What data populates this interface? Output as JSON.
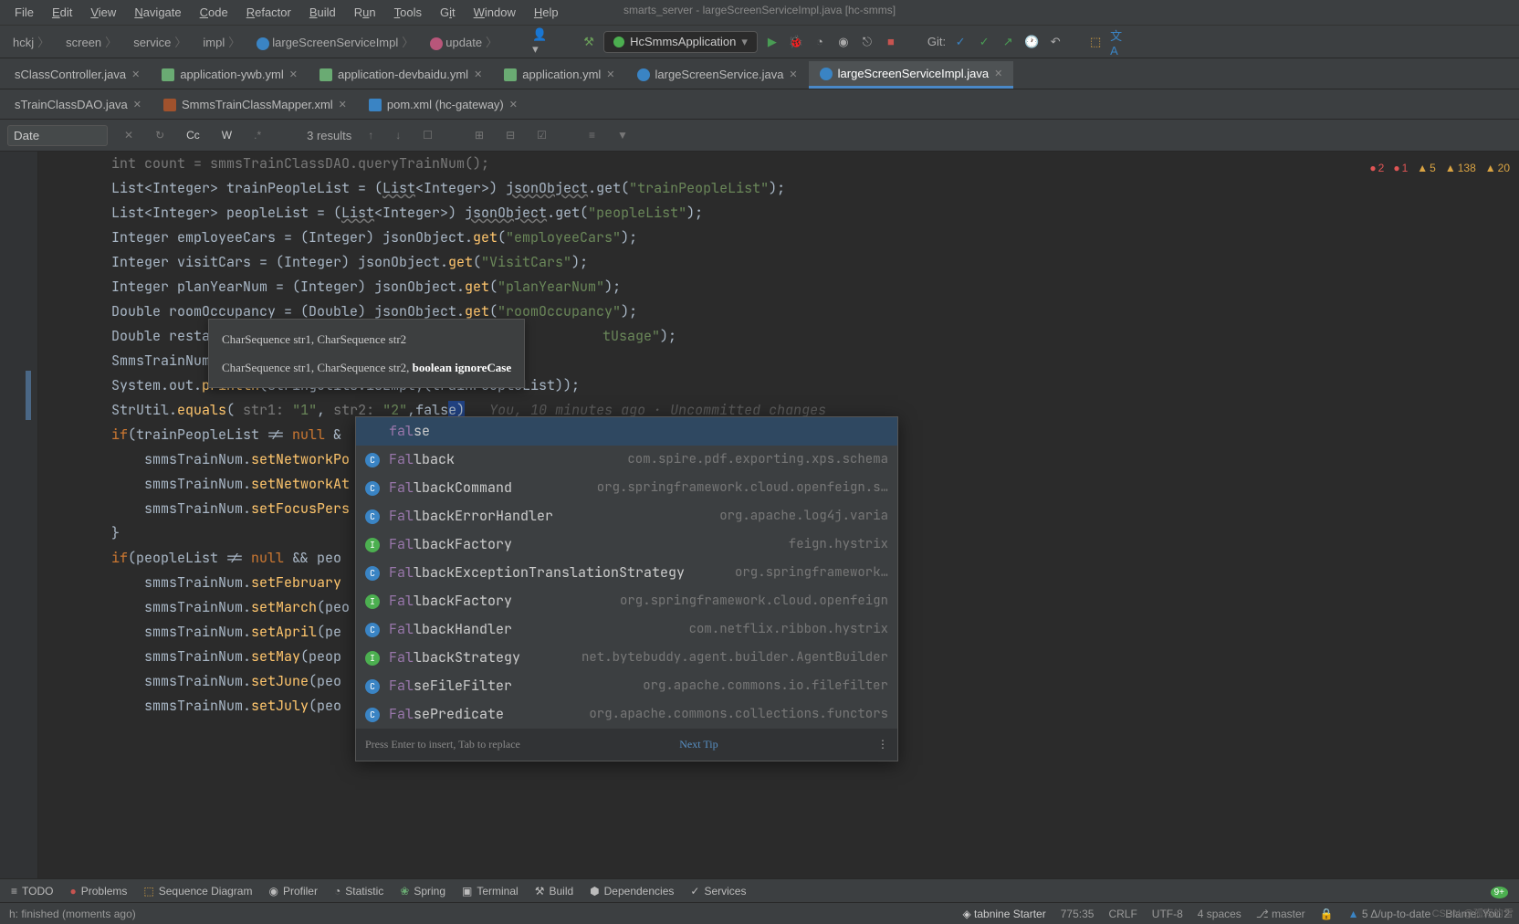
{
  "title": "smarts_server - largeScreenServiceImpl.java [hc-smms]",
  "menu": [
    "File",
    "Edit",
    "View",
    "Navigate",
    "Code",
    "Refactor",
    "Build",
    "Run",
    "Tools",
    "Git",
    "Window",
    "Help"
  ],
  "breadcrumbs": [
    "hckj",
    "screen",
    "service",
    "impl",
    "largeScreenServiceImpl",
    "update"
  ],
  "runConfig": "HcSmmsApplication",
  "gitLabel": "Git:",
  "tabsTop": [
    {
      "label": "sClassController.java",
      "icon": "#3a84c4"
    },
    {
      "label": "application-ywb.yml",
      "icon": "#6aab73"
    },
    {
      "label": "application-devbaidu.yml",
      "icon": "#6aab73"
    },
    {
      "label": "application.yml",
      "icon": "#6aab73"
    },
    {
      "label": "largeScreenService.java",
      "icon": "#3a84c4"
    },
    {
      "label": "largeScreenServiceImpl.java",
      "icon": "#3a84c4",
      "active": true
    }
  ],
  "tabsBottom": [
    {
      "label": "sTrainClassDAO.java",
      "icon": "#3a84c4"
    },
    {
      "label": "SmmsTrainClassMapper.xml",
      "icon": "#a0522d"
    },
    {
      "label": "pom.xml (hc-gateway)",
      "icon": "#3a84c4"
    }
  ],
  "find": {
    "placeholder": "Date",
    "results": "3 results"
  },
  "inspections": {
    "err1": "2",
    "err2": "1",
    "warn1": "5",
    "warn2": "138",
    "warn3": "20"
  },
  "paramPopup": {
    "row1": "CharSequence str1, CharSequence str2",
    "row2a": "CharSequence str1, CharSequence str2, ",
    "row2b": "boolean ignoreCase"
  },
  "code": {
    "l0_pre": "int count = smmsTrainClassDAO.queryTrainNum();",
    "l1": {
      "a": "List<Integer> trainPeopleList = (",
      "b": "List",
      "c": "<Integer>) ",
      "d": "jsonObject",
      "e": ".get(",
      "f": "\"trainPeopleList\"",
      "g": ");"
    },
    "l2": {
      "a": "List<Integer> peopleList = (",
      "b": "List",
      "c": "<Integer>) ",
      "d": "jsonObject",
      "e": ".get(",
      "f": "\"peopleList\"",
      "g": ");"
    },
    "l3": {
      "a": "Integer employeeCars = (Integer) jsonObject.",
      "b": "get",
      "c": "(",
      "d": "\"employeeCars\"",
      "e": ");"
    },
    "l4": {
      "a": "Integer visitCars = (Integer) jsonObject.",
      "b": "get",
      "c": "(",
      "d": "\"VisitCars\"",
      "e": ");"
    },
    "l5": {
      "a": "Integer planYearNum = (Integer) jsonObject.",
      "b": "get",
      "c": "(",
      "d": "\"planYearNum\"",
      "e": ");"
    },
    "l6": {
      "a": "Double roomOccupancy = (Double) jsonObject.",
      "b": "get",
      "c": "(",
      "d": "\"roomOccupancy\"",
      "e": ");"
    },
    "l7": {
      "a": "Double resta",
      "b": "tUsage\"",
      "c": ");"
    },
    "l8": "SmmsTrainNum",
    "l9": {
      "a": "System.out.",
      "b": "println",
      "c": "(StringUtils.isEmpty(trainPeopleList));"
    },
    "l10": {
      "a": "StrUtil.",
      "b": "equals",
      "c": "( ",
      "h1": "str1:",
      "d": " \"1\"",
      "e": ", ",
      "h2": "str2:",
      "f": " \"2\"",
      "g": ",fals",
      "h": "e)",
      "annot": "You, 10 minutes ago · Uncommitted changes"
    },
    "l11": {
      "a": "if",
      "b": "(trainPeopleList != ",
      "c": "null",
      "d": " &"
    },
    "l12": {
      "a": "    smmsTrainNum.",
      "b": "setNetworkPo"
    },
    "l13": {
      "a": "    smmsTrainNum.",
      "b": "setNetworkAt"
    },
    "l14": {
      "a": "    smmsTrainNum.",
      "b": "setFocusPers"
    },
    "l15": "}",
    "l16": {
      "a": "if",
      "b": "(peopleList != ",
      "c": "null",
      "d": " && peo"
    },
    "l17": {
      "a": "    smmsTrainNum.",
      "b": "setFebruary"
    },
    "l18": {
      "a": "    smmsTrainNum.",
      "b": "setMarch",
      "c": "(peo"
    },
    "l19": {
      "a": "    smmsTrainNum.",
      "b": "setApril",
      "c": "(pe"
    },
    "l20": {
      "a": "    smmsTrainNum.",
      "b": "setMay",
      "c": "(peop"
    },
    "l21": {
      "a": "    smmsTrainNum.",
      "b": "setJune",
      "c": "(peo"
    },
    "l22": {
      "a": "    smmsTrainNum.",
      "b": "setJuly",
      "c": "(peo"
    }
  },
  "completion": [
    {
      "ic": "",
      "name": "false",
      "match": "fal",
      "pkg": ""
    },
    {
      "ic": "C",
      "col": "#3a84c4",
      "name": "Fallback",
      "match": "Fal",
      "pkg": "com.spire.pdf.exporting.xps.schema"
    },
    {
      "ic": "C",
      "col": "#3a84c4",
      "name": "FallbackCommand<T>",
      "match": "Fal",
      "pkg": "org.springframework.cloud.openfeign.s…"
    },
    {
      "ic": "C",
      "col": "#3a84c4",
      "name": "FallbackErrorHandler",
      "match": "Fal",
      "pkg": "org.apache.log4j.varia"
    },
    {
      "ic": "I",
      "col": "#4caf50",
      "name": "FallbackFactory<T>",
      "match": "Fal",
      "pkg": "feign.hystrix"
    },
    {
      "ic": "C",
      "col": "#3a84c4",
      "name": "FallbackExceptionTranslationStrategy",
      "match": "Fal",
      "pkg": "org.springframework…"
    },
    {
      "ic": "I",
      "col": "#4caf50",
      "name": "FallbackFactory<T>",
      "match": "Fal",
      "pkg": "org.springframework.cloud.openfeign"
    },
    {
      "ic": "C",
      "col": "#3a84c4",
      "name": "FallbackHandler<T>",
      "match": "Fal",
      "pkg": "com.netflix.ribbon.hystrix"
    },
    {
      "ic": "I",
      "col": "#4caf50",
      "name": "FallbackStrategy",
      "match": "Fal",
      "pkg": "net.bytebuddy.agent.builder.AgentBuilder"
    },
    {
      "ic": "C",
      "col": "#3a84c4",
      "name": "FalseFileFilter",
      "match": "Fal",
      "pkg": "org.apache.commons.io.filefilter"
    },
    {
      "ic": "C",
      "col": "#3a84c4",
      "name": "FalsePredicate",
      "match": "Fal",
      "pkg": "org.apache.commons.collections.functors"
    }
  ],
  "completionFooter": {
    "hint": "Press Enter to insert, Tab to replace",
    "link": "Next Tip"
  },
  "bottomTools": [
    "TODO",
    "Problems",
    "Sequence Diagram",
    "Profiler",
    "Statistic",
    "Spring",
    "Terminal",
    "Build",
    "Dependencies",
    "Services"
  ],
  "status": {
    "left": "h: finished (moments ago)",
    "tabnine": "tabnine Starter",
    "pos": "775:35",
    "eol": "CRLF",
    "enc": "UTF-8",
    "indent": "4 spaces",
    "branch": "master",
    "uptodate": "5 Δ/up-to-date",
    "blame": "Blame: You 2"
  },
  "watermark": "CSDN @孤寂的雪"
}
